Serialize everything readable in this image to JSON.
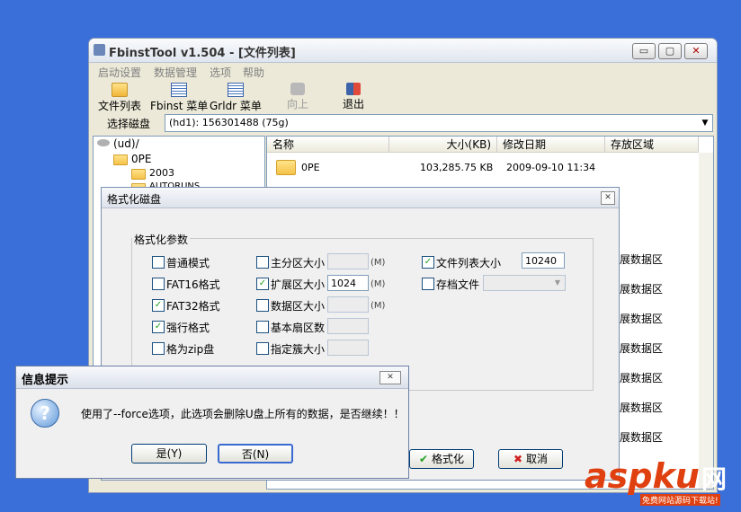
{
  "window": {
    "title": "FbinstTool v1.504 - [文件列表]",
    "minimize": "▭",
    "maximize": "▢",
    "close": "✕"
  },
  "menu": [
    "启动设置",
    "数据管理",
    "选项",
    "帮助"
  ],
  "toolbar": {
    "file_list": "文件列表",
    "fbinst_menu": "Fbinst 菜单",
    "grldr_menu": "Grldr 菜单",
    "up": "向上",
    "exit": "退出"
  },
  "disk_select": {
    "label": "选择磁盘",
    "value": "(hd1): 156301488 (75g)"
  },
  "tree": {
    "root": "(ud)/",
    "items": [
      "0PE",
      "2003",
      "AUTORUNS"
    ]
  },
  "list": {
    "columns": [
      "名称",
      "大小(KB)",
      "修改日期",
      "存放区域"
    ],
    "rows": [
      {
        "name": "0PE",
        "size": "103,285.75 KB",
        "date": "2009-09-10 11:34",
        "area": ""
      }
    ],
    "area_partial": [
      "展数据区",
      "展数据区",
      "展数据区",
      "展数据区",
      "展数据区",
      "展数据区",
      "展数据区"
    ]
  },
  "format_dialog": {
    "title": "格式化磁盘",
    "group": "格式化参数",
    "col1": [
      {
        "label": "普通模式",
        "checked": false
      },
      {
        "label": "FAT16格式",
        "checked": false
      },
      {
        "label": "FAT32格式",
        "checked": true
      },
      {
        "label": "强行格式",
        "checked": true
      },
      {
        "label": "格为zip盘",
        "checked": false
      }
    ],
    "col2": [
      {
        "label": "主分区大小",
        "checked": false,
        "value": "",
        "unit": "(M)"
      },
      {
        "label": "扩展区大小",
        "checked": true,
        "value": "1024",
        "unit": "(M)"
      },
      {
        "label": "数据区大小",
        "checked": false,
        "value": "",
        "unit": "(M)"
      },
      {
        "label": "基本扇区数",
        "checked": false,
        "value": "",
        "unit": ""
      },
      {
        "label": "指定簇大小",
        "checked": false,
        "value": "",
        "unit": ""
      }
    ],
    "col3": [
      {
        "label": "文件列表大小",
        "checked": true,
        "value": "10240"
      },
      {
        "label": "存档文件",
        "checked": false,
        "value": ""
      }
    ],
    "format_button": "格式化",
    "cancel_button": "取消"
  },
  "info_dialog": {
    "title": "信息提示",
    "message": "使用了--force选项，此选项会删除U盘上所有的数据，是否继续！！",
    "yes_button": "是(Y)",
    "no_button": "否(N)"
  },
  "watermark": {
    "brand": "aspku",
    "suffix": "网",
    "slogan": "免费网站源码下载站!"
  },
  "colors": {
    "desktop": "#3a6ed8",
    "accent": "#f07a10",
    "check": "#21a121"
  }
}
